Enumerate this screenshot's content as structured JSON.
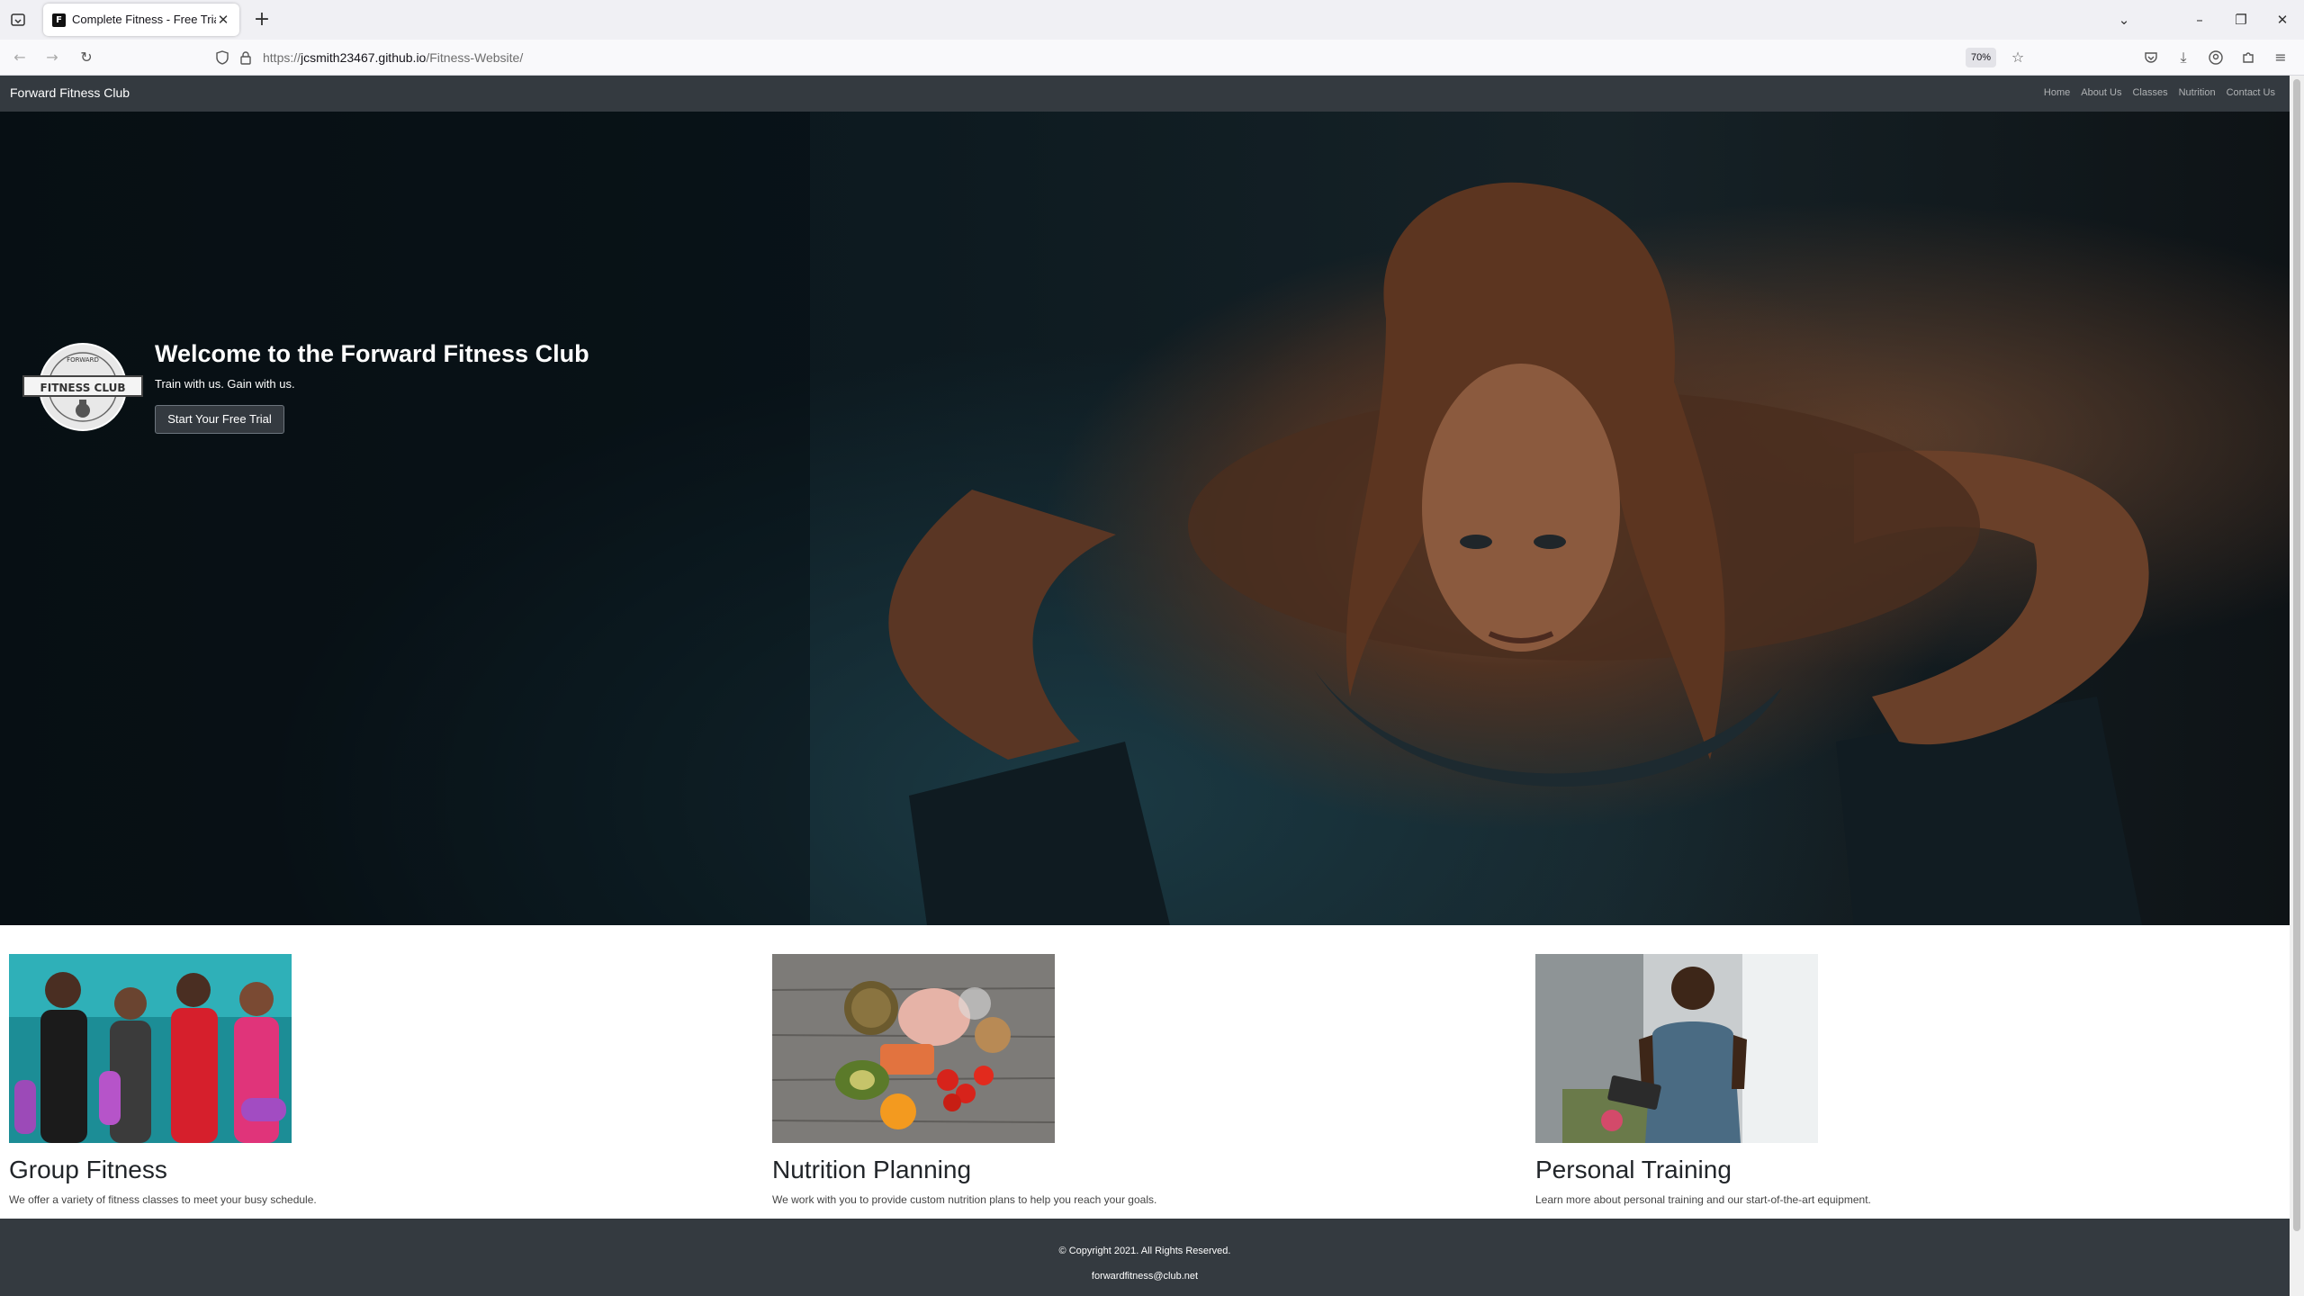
{
  "browser": {
    "tab_title": "Complete Fitness - Free Trial | F",
    "tab_favicon": "F",
    "url_prefix": "https://",
    "url_host": "jcsmith23467.github.io",
    "url_path": "/Fitness-Website/",
    "zoom": "70%"
  },
  "site": {
    "brand": "Forward Fitness Club",
    "nav": [
      "Home",
      "About Us",
      "Classes",
      "Nutrition",
      "Contact Us"
    ]
  },
  "hero": {
    "logo_text": "FITNESS CLUB",
    "logo_top": "FORWARD",
    "title": "Welcome to the Forward Fitness Club",
    "subtitle": "Train with us. Gain with us.",
    "button": "Start Your Free Trial"
  },
  "cards": [
    {
      "title": "Group Fitness",
      "text": "We offer a variety of fitness classes to meet your busy schedule."
    },
    {
      "title": "Nutrition Planning",
      "text": "We work with you to provide custom nutrition plans to help you reach your goals."
    },
    {
      "title": "Personal Training",
      "text": "Learn more about personal training and our start-of-the-art equipment."
    }
  ],
  "footer": {
    "copyright": "© Copyright 2021. All Rights Reserved.",
    "email": "forwardfitness@club.net"
  },
  "colors": {
    "navbar_bg": "#343a40",
    "footer_bg": "#343a40"
  }
}
